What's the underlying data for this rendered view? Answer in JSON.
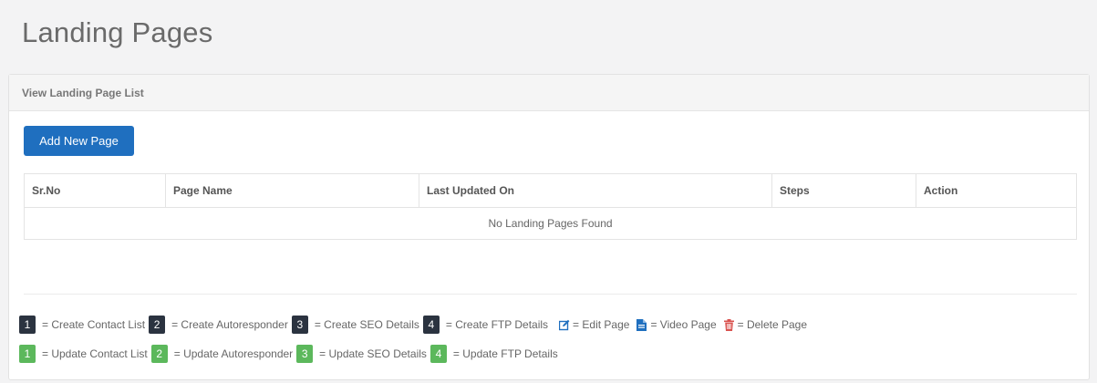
{
  "page": {
    "title": "Landing Pages"
  },
  "panel": {
    "heading": "View Landing Page List",
    "add_button_label": "Add New Page"
  },
  "table": {
    "headers": [
      "Sr.No",
      "Page Name",
      "Last Updated On",
      "Steps",
      "Action"
    ],
    "empty_message": "No Landing Pages Found"
  },
  "legend": {
    "create": [
      {
        "num": "1",
        "label": "= Create Contact List"
      },
      {
        "num": "2",
        "label": "= Create Autoresponder"
      },
      {
        "num": "3",
        "label": "= Create SEO Details"
      },
      {
        "num": "4",
        "label": "= Create FTP Details"
      }
    ],
    "update": [
      {
        "num": "1",
        "label": "= Update Contact List"
      },
      {
        "num": "2",
        "label": "= Update Autoresponder"
      },
      {
        "num": "3",
        "label": "= Update SEO Details"
      },
      {
        "num": "4",
        "label": "= Update FTP Details"
      }
    ],
    "actions": {
      "edit": {
        "icon": "edit-icon",
        "label": "= Edit Page"
      },
      "video": {
        "icon": "file-icon",
        "label": "= Video Page"
      },
      "delete": {
        "icon": "trash-icon",
        "label": "= Delete Page"
      }
    }
  },
  "colors": {
    "primary": "#1f6fbf",
    "badge_dark": "#2b3340",
    "badge_green": "#5cb85c",
    "danger": "#d9534f"
  }
}
